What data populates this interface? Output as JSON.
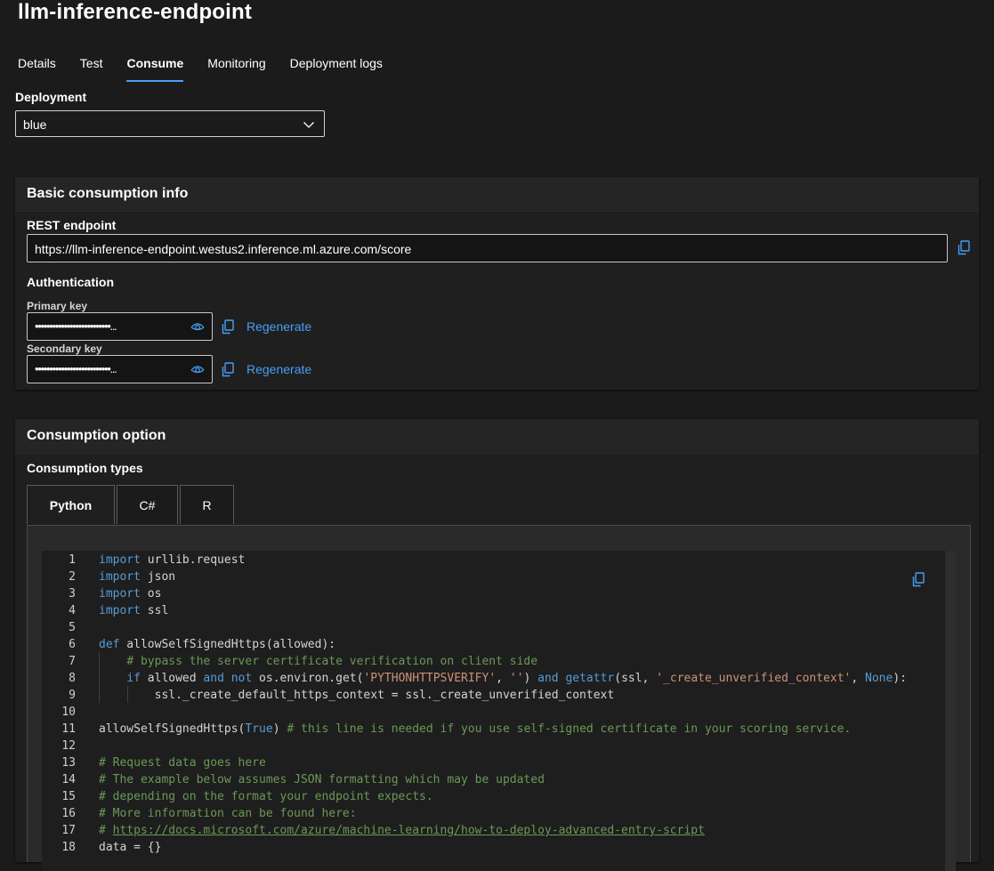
{
  "page": {
    "title": "llm-inference-endpoint"
  },
  "tabs": [
    {
      "label": "Details",
      "active": false
    },
    {
      "label": "Test",
      "active": false
    },
    {
      "label": "Consume",
      "active": true
    },
    {
      "label": "Monitoring",
      "active": false
    },
    {
      "label": "Deployment logs",
      "active": false
    }
  ],
  "deployment": {
    "label": "Deployment",
    "value": "blue"
  },
  "basic_info": {
    "title": "Basic consumption info",
    "rest_endpoint_label": "REST endpoint",
    "rest_endpoint_value": "https://llm-inference-endpoint.westus2.inference.ml.azure.com/score",
    "authentication_label": "Authentication",
    "primary_key_label": "Primary key",
    "primary_key_value": "••••••••••••••••••••••••••...",
    "secondary_key_label": "Secondary key",
    "secondary_key_value": "••••••••••••••••••••••••••...",
    "regenerate_label": "Regenerate"
  },
  "consumption": {
    "title": "Consumption option",
    "types_label": "Consumption types",
    "types": [
      "Python",
      "C#",
      "R"
    ],
    "active_type": "Python"
  },
  "code": {
    "line_numbers": [
      "1",
      "2",
      "3",
      "4",
      "5",
      "6",
      "7",
      "8",
      "9",
      "10",
      "11",
      "12",
      "13",
      "14",
      "15",
      "16",
      "17",
      "18"
    ],
    "lines": [
      [
        {
          "t": "import",
          "c": "kw"
        },
        {
          "t": " urllib.request"
        }
      ],
      [
        {
          "t": "import",
          "c": "kw"
        },
        {
          "t": " json"
        }
      ],
      [
        {
          "t": "import",
          "c": "kw"
        },
        {
          "t": " os"
        }
      ],
      [
        {
          "t": "import",
          "c": "kw"
        },
        {
          "t": " ssl"
        }
      ],
      [],
      [
        {
          "t": "def",
          "c": "kw"
        },
        {
          "t": " allowSelfSignedHttps(allowed):"
        }
      ],
      [
        {
          "t": "    "
        },
        {
          "t": "# bypass the server certificate verification on client side",
          "c": "cm"
        }
      ],
      [
        {
          "t": "    "
        },
        {
          "t": "if",
          "c": "kw"
        },
        {
          "t": " allowed "
        },
        {
          "t": "and",
          "c": "kw"
        },
        {
          "t": " "
        },
        {
          "t": "not",
          "c": "kw"
        },
        {
          "t": " os.environ.get("
        },
        {
          "t": "'PYTHONHTTPSVERIFY'",
          "c": "st"
        },
        {
          "t": ", "
        },
        {
          "t": "''",
          "c": "st"
        },
        {
          "t": ") "
        },
        {
          "t": "and",
          "c": "kw"
        },
        {
          "t": " "
        },
        {
          "t": "getattr",
          "c": "kw"
        },
        {
          "t": "(ssl, "
        },
        {
          "t": "'_create_unverified_context'",
          "c": "st"
        },
        {
          "t": ", "
        },
        {
          "t": "None",
          "c": "kw"
        },
        {
          "t": "):"
        }
      ],
      [
        {
          "t": "        ssl._create_default_https_context = ssl._create_unverified_context"
        }
      ],
      [],
      [
        {
          "t": "allowSelfSignedHttps("
        },
        {
          "t": "True",
          "c": "kw"
        },
        {
          "t": ") "
        },
        {
          "t": "# this line is needed if you use self-signed certificate in your scoring service.",
          "c": "cm"
        }
      ],
      [],
      [
        {
          "t": "# Request data goes here",
          "c": "cm"
        }
      ],
      [
        {
          "t": "# The example below assumes JSON formatting which may be updated",
          "c": "cm"
        }
      ],
      [
        {
          "t": "# depending on the format your endpoint expects.",
          "c": "cm"
        }
      ],
      [
        {
          "t": "# More information can be found here:",
          "c": "cm"
        }
      ],
      [
        {
          "t": "# ",
          "c": "cm"
        },
        {
          "t": "https://docs.microsoft.com/azure/machine-learning/how-to-deploy-advanced-entry-script",
          "c": "lk"
        }
      ],
      [
        {
          "t": "data = {}"
        }
      ]
    ]
  },
  "icons": {
    "copy": "copy-icon",
    "eye": "eye-icon",
    "chevron": "chevron-down-icon"
  },
  "colors": {
    "accent": "#479ef5",
    "background": "#1b1b1b"
  }
}
